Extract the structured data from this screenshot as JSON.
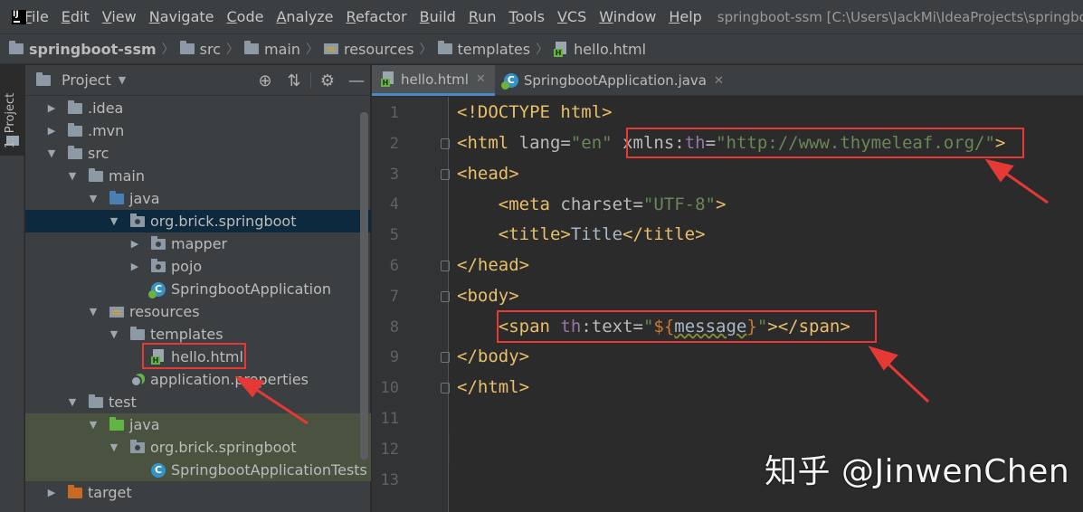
{
  "menubar": {
    "items": [
      "File",
      "Edit",
      "View",
      "Navigate",
      "Code",
      "Analyze",
      "Refactor",
      "Build",
      "Run",
      "Tools",
      "VCS",
      "Window",
      "Help"
    ],
    "window_title": "springboot-ssm [C:\\Users\\JackMi\\IdeaProjects\\springboo"
  },
  "breadcrumb": [
    "springboot-ssm",
    "src",
    "main",
    "resources",
    "templates",
    "hello.html"
  ],
  "sidestrip": {
    "label": "1: Project"
  },
  "project": {
    "title": "Project",
    "tree": [
      {
        "label": ".idea",
        "depth": 1,
        "arrow": "▶",
        "icon": "folder"
      },
      {
        "label": ".mvn",
        "depth": 1,
        "arrow": "▶",
        "icon": "folder"
      },
      {
        "label": "src",
        "depth": 1,
        "arrow": "▼",
        "icon": "folder"
      },
      {
        "label": "main",
        "depth": 2,
        "arrow": "▼",
        "icon": "folder"
      },
      {
        "label": "java",
        "depth": 3,
        "arrow": "▼",
        "icon": "folder-blue"
      },
      {
        "label": "org.brick.springboot",
        "depth": 4,
        "arrow": "▼",
        "icon": "package",
        "selected": true
      },
      {
        "label": "mapper",
        "depth": 5,
        "arrow": "▶",
        "icon": "package"
      },
      {
        "label": "pojo",
        "depth": 5,
        "arrow": "▶",
        "icon": "package"
      },
      {
        "label": "SpringbootApplication",
        "depth": 5,
        "arrow": "",
        "icon": "spring-class"
      },
      {
        "label": "resources",
        "depth": 3,
        "arrow": "▼",
        "icon": "resources"
      },
      {
        "label": "templates",
        "depth": 4,
        "arrow": "▼",
        "icon": "folder"
      },
      {
        "label": "hello.html",
        "depth": 5,
        "arrow": "",
        "icon": "html"
      },
      {
        "label": "application.properties",
        "depth": 4,
        "arrow": "",
        "icon": "properties"
      },
      {
        "label": "test",
        "depth": 2,
        "arrow": "▼",
        "icon": "folder"
      },
      {
        "label": "java",
        "depth": 3,
        "arrow": "▼",
        "icon": "folder-green",
        "test": true
      },
      {
        "label": "org.brick.springboot",
        "depth": 4,
        "arrow": "▼",
        "icon": "package",
        "test": true
      },
      {
        "label": "SpringbootApplicationTests",
        "depth": 5,
        "arrow": "",
        "icon": "class",
        "test": true
      },
      {
        "label": "target",
        "depth": 1,
        "arrow": "▶",
        "icon": "folder-orange"
      }
    ]
  },
  "editor": {
    "tabs": [
      {
        "label": "hello.html",
        "icon": "html",
        "active": true
      },
      {
        "label": "SpringbootApplication.java",
        "icon": "spring-class",
        "active": false
      }
    ],
    "line_numbers": [
      "1",
      "2",
      "3",
      "4",
      "5",
      "6",
      "7",
      "8",
      "9",
      "10",
      "11",
      "12",
      "13"
    ],
    "code": {
      "l1": "<!DOCTYPE html>",
      "l2_tag": "<html",
      "l2_attr": " lang=",
      "l2_val": "\"en\"",
      "l2_xmlns": "xmlns",
      "l2_colon": ":",
      "l2_th": "th",
      "l2_eq": "=",
      "l2_url": "\"http://www.thymeleaf.org/\"",
      "l2_end": ">",
      "l3": "<head>",
      "l4_tag": "<meta",
      "l4_attr": " charset=",
      "l4_val": "\"UTF-8\"",
      "l4_end": ">",
      "l5_open": "<title>",
      "l5_text": "Title",
      "l5_close": "</title>",
      "l6": "</head>",
      "l7": "<body>",
      "l8_tag": "<span",
      "l8_th": "th",
      "l8_attr": ":text=",
      "l8_q1": "\"",
      "l8_ph": "${",
      "l8_var": "message",
      "l8_ph2": "}",
      "l8_q2": "\"",
      "l8_end": "></span>",
      "l9": "</body>",
      "l10": "</html>"
    }
  },
  "watermark": "知乎 @JinwenChen",
  "colors": {
    "highlight_box": "#e53935",
    "tag": "#e8bf6a",
    "string": "#6a8759",
    "namespace": "#9876aa"
  }
}
